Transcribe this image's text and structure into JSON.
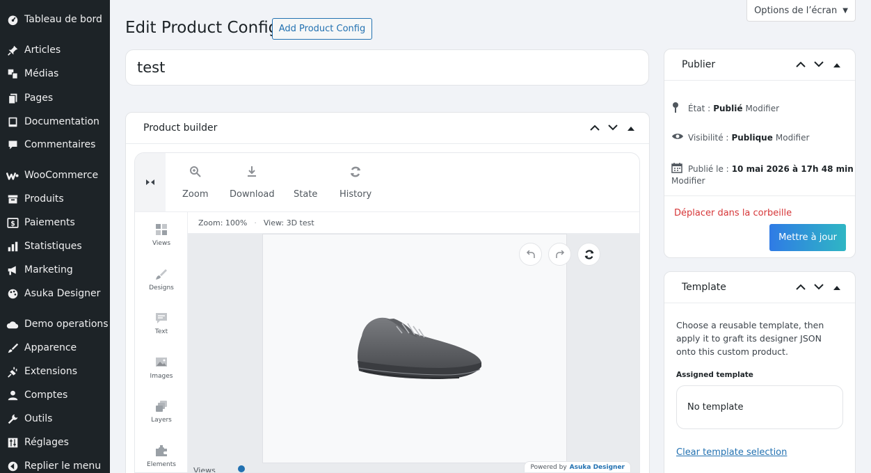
{
  "sidebar": {
    "items": [
      {
        "label": "Tableau de bord",
        "icon": "dashboard-icon"
      },
      {
        "label": "Articles",
        "icon": "pin-icon"
      },
      {
        "label": "Médias",
        "icon": "media-icon"
      },
      {
        "label": "Pages",
        "icon": "pages-icon"
      },
      {
        "label": "Documentation",
        "icon": "book-icon"
      },
      {
        "label": "Commentaires",
        "icon": "comment-icon"
      },
      {
        "label": "WooCommerce",
        "icon": "woocommerce-icon"
      },
      {
        "label": "Produits",
        "icon": "archive-icon"
      },
      {
        "label": "Paiements",
        "icon": "dollar-icon"
      },
      {
        "label": "Statistiques",
        "icon": "chart-icon"
      },
      {
        "label": "Marketing",
        "icon": "megaphone-icon"
      },
      {
        "label": "Asuka Designer",
        "icon": "palette-icon"
      },
      {
        "label": "Demo operations",
        "icon": "cloud-icon"
      },
      {
        "label": "Apparence",
        "icon": "brush-icon"
      },
      {
        "label": "Extensions",
        "icon": "plug-icon"
      },
      {
        "label": "Comptes",
        "icon": "user-icon"
      },
      {
        "label": "Outils",
        "icon": "wrench-icon"
      },
      {
        "label": "Réglages",
        "icon": "settings-icon"
      },
      {
        "label": "Replier le menu",
        "icon": "collapse-icon"
      }
    ]
  },
  "header": {
    "screen_options": "Options de l’écran",
    "title": "Edit Product Config",
    "add_button": "Add Product Config"
  },
  "post_title": "test",
  "builder": {
    "title": "Product builder",
    "tools": [
      {
        "label": "Zoom",
        "icon": "zoom-in-icon"
      },
      {
        "label": "Download",
        "icon": "download-icon"
      },
      {
        "label": "State",
        "icon": "state-icon"
      },
      {
        "label": "History",
        "icon": "history-icon"
      }
    ],
    "rail": [
      {
        "label": "Views",
        "icon": "views-icon"
      },
      {
        "label": "Designs",
        "icon": "designs-icon"
      },
      {
        "label": "Text",
        "icon": "text-icon"
      },
      {
        "label": "Images",
        "icon": "images-icon"
      },
      {
        "label": "Layers",
        "icon": "layers-icon"
      },
      {
        "label": "Elements",
        "icon": "elements-icon"
      }
    ],
    "zoom_status": "Zoom: 100%",
    "view_status": "View: 3D test",
    "views_label": "Views",
    "powered_by": "Powered by",
    "powered_brand": "Asuka Designer"
  },
  "publish": {
    "title": "Publier",
    "status_label": "État :",
    "status_value": "Publié",
    "visibility_label": "Visibilité :",
    "visibility_value": "Publique",
    "published_label": "Publié le :",
    "published_value": "10 mai 2026 à 17h 48 min",
    "modify": "Modifier",
    "trash": "Déplacer dans la corbeille",
    "update": "Mettre à jour"
  },
  "template": {
    "title": "Template",
    "description": "Choose a reusable template, then apply it to graft its designer JSON onto this custom product.",
    "assigned_label": "Assigned template",
    "selected": "No template",
    "clear": "Clear template selection"
  },
  "colors": {
    "sidebar_bg": "#1d2327",
    "accent": "#2271b1",
    "danger": "#d63638",
    "button_gradient_start": "#2f7be5",
    "button_gradient_end": "#2fb6c4"
  }
}
